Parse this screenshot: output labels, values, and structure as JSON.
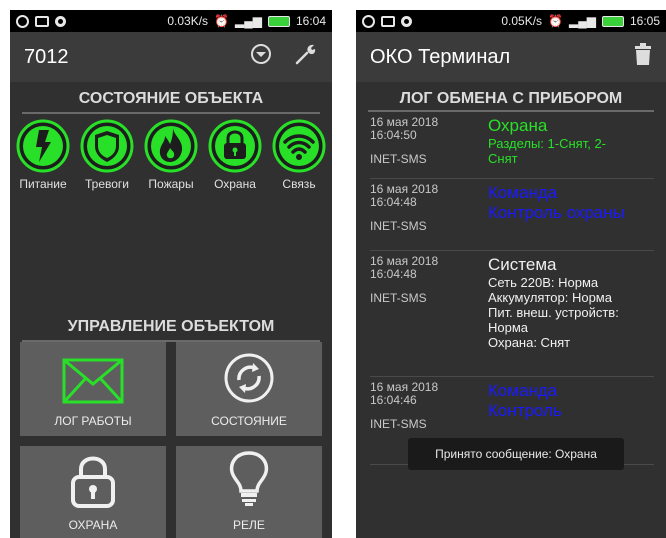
{
  "left_screen": {
    "statusbar": {
      "net_speed": "0.03K/s",
      "time": "16:04"
    },
    "appbar": {
      "title": "7012"
    },
    "object_status": {
      "title": "СОСТОЯНИЕ ОБЪЕКТА",
      "items": [
        {
          "label": "Питание",
          "icon": "power-bolt-icon"
        },
        {
          "label": "Тревоги",
          "icon": "shield-icon"
        },
        {
          "label": "Пожары",
          "icon": "flame-icon"
        },
        {
          "label": "Охрана",
          "icon": "lock-icon"
        },
        {
          "label": "Связь",
          "icon": "wifi-icon"
        }
      ]
    },
    "object_control": {
      "title": "УПРАВЛЕНИЕ ОБЪЕКТОМ",
      "tiles": [
        {
          "label": "ЛОГ РАБОТЫ",
          "icon": "envelope-icon"
        },
        {
          "label": "СОСТОЯНИЕ",
          "icon": "refresh-icon"
        },
        {
          "label": "ОХРАНА",
          "icon": "lock-icon"
        },
        {
          "label": "РЕЛЕ",
          "icon": "lightbulb-icon"
        }
      ]
    },
    "colors": {
      "accent": "#28e028",
      "tile_bg": "#5e5e5e"
    }
  },
  "right_screen": {
    "statusbar": {
      "net_speed": "0.05K/s",
      "time": "16:05"
    },
    "appbar": {
      "title": "ОКО Терминал"
    },
    "log": {
      "title": "ЛОГ ОБМЕНА С ПРИБОРОМ",
      "entries": [
        {
          "date": "16 мая 2018",
          "time": "16:04:50",
          "source": "INET-SMS",
          "head": "Охрана",
          "body": [
            "Разделы: 1-Снят, 2-",
            "Снят"
          ]
        },
        {
          "date": "16 мая 2018",
          "time": "16:04:48",
          "source": "INET-SMS",
          "head": "Команда",
          "body": [
            "Контроль охраны"
          ]
        },
        {
          "date": "16 мая 2018",
          "time": "16:04:48",
          "source": "INET-SMS",
          "head": "Система",
          "body": [
            "Сеть 220В: Норма",
            "Аккумулятор: Норма",
            "Пит. внеш. устройств:",
            "Норма",
            "Охрана: Снят"
          ]
        },
        {
          "date": "16 мая 2018",
          "time": "16:04:46",
          "source": "INET-SMS",
          "head": "Команда",
          "body": [
            "Контроль"
          ]
        }
      ]
    },
    "toast": "Принято сообщение: Охрана"
  }
}
